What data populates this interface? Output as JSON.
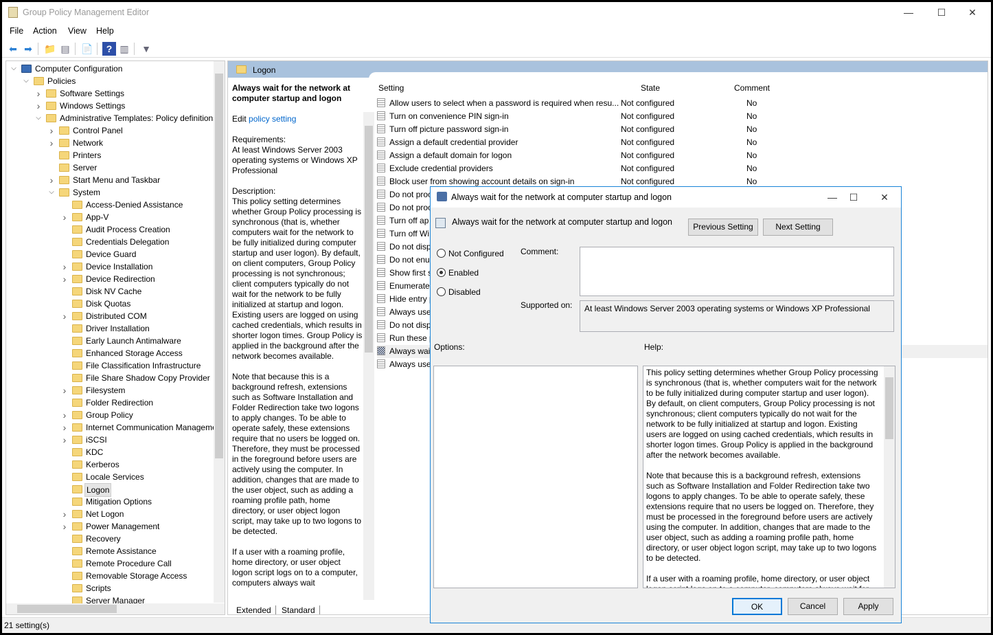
{
  "window": {
    "title": "Group Policy Management Editor",
    "controls": [
      "—",
      "☐",
      "✕"
    ]
  },
  "menu": [
    "File",
    "Action",
    "View",
    "Help"
  ],
  "toolbar": [
    {
      "icon": "back-arrow-icon",
      "g": "⬅"
    },
    {
      "icon": "forward-arrow-icon",
      "g": "➡"
    },
    {
      "icon": "up-folder-icon",
      "g": "📁"
    },
    {
      "icon": "show-hide-tree-icon",
      "g": "▤"
    },
    {
      "icon": "export-list-icon",
      "g": "📄"
    },
    {
      "icon": "help-icon",
      "g": "?"
    },
    {
      "icon": "show-hide-action-pane-icon",
      "g": "▥"
    },
    {
      "icon": "filter-icon",
      "g": "▼"
    }
  ],
  "tree": [
    {
      "label": "Computer Configuration",
      "level": 0,
      "state": "expanded",
      "icon": "computer"
    },
    {
      "label": "Policies",
      "level": 1,
      "state": "expanded"
    },
    {
      "label": "Software Settings",
      "level": 2,
      "state": "collapsed"
    },
    {
      "label": "Windows Settings",
      "level": 2,
      "state": "collapsed"
    },
    {
      "label": "Administrative Templates: Policy definitions",
      "level": 2,
      "state": "expanded"
    },
    {
      "label": "Control Panel",
      "level": 3,
      "state": "collapsed"
    },
    {
      "label": "Network",
      "level": 3,
      "state": "collapsed"
    },
    {
      "label": "Printers",
      "level": 3,
      "state": "none"
    },
    {
      "label": "Server",
      "level": 3,
      "state": "none"
    },
    {
      "label": "Start Menu and Taskbar",
      "level": 3,
      "state": "collapsed"
    },
    {
      "label": "System",
      "level": 3,
      "state": "expanded"
    },
    {
      "label": "Access-Denied Assistance",
      "level": 4,
      "state": "none"
    },
    {
      "label": "App-V",
      "level": 4,
      "state": "collapsed"
    },
    {
      "label": "Audit Process Creation",
      "level": 4,
      "state": "none"
    },
    {
      "label": "Credentials Delegation",
      "level": 4,
      "state": "none"
    },
    {
      "label": "Device Guard",
      "level": 4,
      "state": "none"
    },
    {
      "label": "Device Installation",
      "level": 4,
      "state": "collapsed"
    },
    {
      "label": "Device Redirection",
      "level": 4,
      "state": "collapsed"
    },
    {
      "label": "Disk NV Cache",
      "level": 4,
      "state": "none"
    },
    {
      "label": "Disk Quotas",
      "level": 4,
      "state": "none"
    },
    {
      "label": "Distributed COM",
      "level": 4,
      "state": "collapsed"
    },
    {
      "label": "Driver Installation",
      "level": 4,
      "state": "none"
    },
    {
      "label": "Early Launch Antimalware",
      "level": 4,
      "state": "none"
    },
    {
      "label": "Enhanced Storage Access",
      "level": 4,
      "state": "none"
    },
    {
      "label": "File Classification Infrastructure",
      "level": 4,
      "state": "none"
    },
    {
      "label": "File Share Shadow Copy Provider",
      "level": 4,
      "state": "none"
    },
    {
      "label": "Filesystem",
      "level": 4,
      "state": "collapsed"
    },
    {
      "label": "Folder Redirection",
      "level": 4,
      "state": "none"
    },
    {
      "label": "Group Policy",
      "level": 4,
      "state": "collapsed"
    },
    {
      "label": "Internet Communication Management",
      "level": 4,
      "state": "collapsed"
    },
    {
      "label": "iSCSI",
      "level": 4,
      "state": "collapsed"
    },
    {
      "label": "KDC",
      "level": 4,
      "state": "none"
    },
    {
      "label": "Kerberos",
      "level": 4,
      "state": "none"
    },
    {
      "label": "Locale Services",
      "level": 4,
      "state": "none"
    },
    {
      "label": "Logon",
      "level": 4,
      "state": "none",
      "selected": true
    },
    {
      "label": "Mitigation Options",
      "level": 4,
      "state": "none"
    },
    {
      "label": "Net Logon",
      "level": 4,
      "state": "collapsed"
    },
    {
      "label": "Power Management",
      "level": 4,
      "state": "collapsed"
    },
    {
      "label": "Recovery",
      "level": 4,
      "state": "none"
    },
    {
      "label": "Remote Assistance",
      "level": 4,
      "state": "none"
    },
    {
      "label": "Remote Procedure Call",
      "level": 4,
      "state": "none"
    },
    {
      "label": "Removable Storage Access",
      "level": 4,
      "state": "none"
    },
    {
      "label": "Scripts",
      "level": 4,
      "state": "none"
    },
    {
      "label": "Server Manager",
      "level": 4,
      "state": "none"
    }
  ],
  "pane": {
    "header": "Logon",
    "desc_title": "Always wait for the network at computer startup and logon",
    "edit_prefix": "Edit ",
    "edit_link": "policy setting",
    "requirements": "Requirements:\nAt least Windows Server 2003 operating systems or Windows XP Professional",
    "description": [
      "Description:\nThis policy setting determines whether Group Policy processing is synchronous (that is, whether computers wait for the network to be fully initialized during computer startup and user logon). By default, on client computers, Group Policy processing is not synchronous; client computers typically do not wait for the network to be fully initialized at startup and logon. Existing users are logged on using cached credentials, which results in shorter logon times. Group Policy is applied in the background after the network becomes available.",
      "Note that because this is a background refresh, extensions such as Software Installation and Folder Redirection take two logons to apply changes. To be able to operate safely, these extensions require that no users be logged on. Therefore, they must be processed in the foreground before users are actively using the computer. In addition, changes that are made to the user object, such as adding a roaming profile path, home directory, or user object logon script, may take up to two logons to be detected.",
      "If a user with a roaming profile, home directory, or user object logon script logs on to a computer, computers always wait"
    ],
    "tabs": [
      "Extended",
      "Standard"
    ]
  },
  "list": {
    "columns": [
      "Setting",
      "State",
      "Comment"
    ],
    "rows": [
      [
        "Allow users to select when a password is required when resu...",
        "Not configured",
        "No"
      ],
      [
        "Turn on convenience PIN sign-in",
        "Not configured",
        "No"
      ],
      [
        "Turn off picture password sign-in",
        "Not configured",
        "No"
      ],
      [
        "Assign a default credential provider",
        "Not configured",
        "No"
      ],
      [
        "Assign a default domain for logon",
        "Not configured",
        "No"
      ],
      [
        "Exclude credential providers",
        "Not configured",
        "No"
      ],
      [
        "Block user from showing account details on sign-in",
        "Not configured",
        "No"
      ],
      [
        "Do not proc",
        "",
        ""
      ],
      [
        "Do not proc",
        "",
        ""
      ],
      [
        "Turn off ap",
        "",
        ""
      ],
      [
        "Turn off Wi",
        "",
        ""
      ],
      [
        "Do not disp",
        "",
        ""
      ],
      [
        "Do not enu",
        "",
        ""
      ],
      [
        "Show first s",
        "",
        ""
      ],
      [
        "Enumerate",
        "",
        ""
      ],
      [
        "Hide entry p",
        "",
        ""
      ],
      [
        "Always use",
        "",
        ""
      ],
      [
        "Do not disp",
        "",
        ""
      ],
      [
        "Run these p",
        "",
        ""
      ],
      [
        "Always wait",
        "",
        ""
      ],
      [
        "Always use",
        "",
        ""
      ]
    ],
    "selected_index": 19
  },
  "dialog": {
    "title": "Always wait for the network at computer startup and logon",
    "setting_name": "Always wait for the network at computer startup and logon",
    "prev": "Previous Setting",
    "next": "Next Setting",
    "radios": [
      {
        "label": "Not Configured",
        "checked": false
      },
      {
        "label": "Enabled",
        "checked": true
      },
      {
        "label": "Disabled",
        "checked": false
      }
    ],
    "comment_label": "Comment:",
    "comment_value": "",
    "supported_label": "Supported on:",
    "supported_value": "At least Windows Server 2003 operating systems or Windows XP Professional",
    "options_label": "Options:",
    "help_label": "Help:",
    "help": [
      "This policy setting determines whether Group Policy processing is synchronous (that is, whether computers wait for the network to be fully initialized during computer startup and user logon). By default, on client computers, Group Policy processing is not synchronous; client computers typically do not wait for the network to be fully initialized at startup and logon. Existing users are logged on using cached credentials, which results in shorter logon times. Group Policy is applied in the background after the network becomes available.",
      "Note that because this is a background refresh, extensions such as Software Installation and Folder Redirection take two logons to apply changes. To be able to operate safely, these extensions require that no users be logged on. Therefore, they must be processed in the foreground before users are actively using the computer. In addition, changes that are made to the user object, such as adding a roaming profile path, home directory, or user object logon script, may take up to two logons to be detected.",
      "If a user with a roaming profile, home directory, or user object logon script logs on to a computer, computers always wait for"
    ],
    "ok": "OK",
    "cancel": "Cancel",
    "apply": "Apply"
  },
  "status": "21 setting(s)"
}
